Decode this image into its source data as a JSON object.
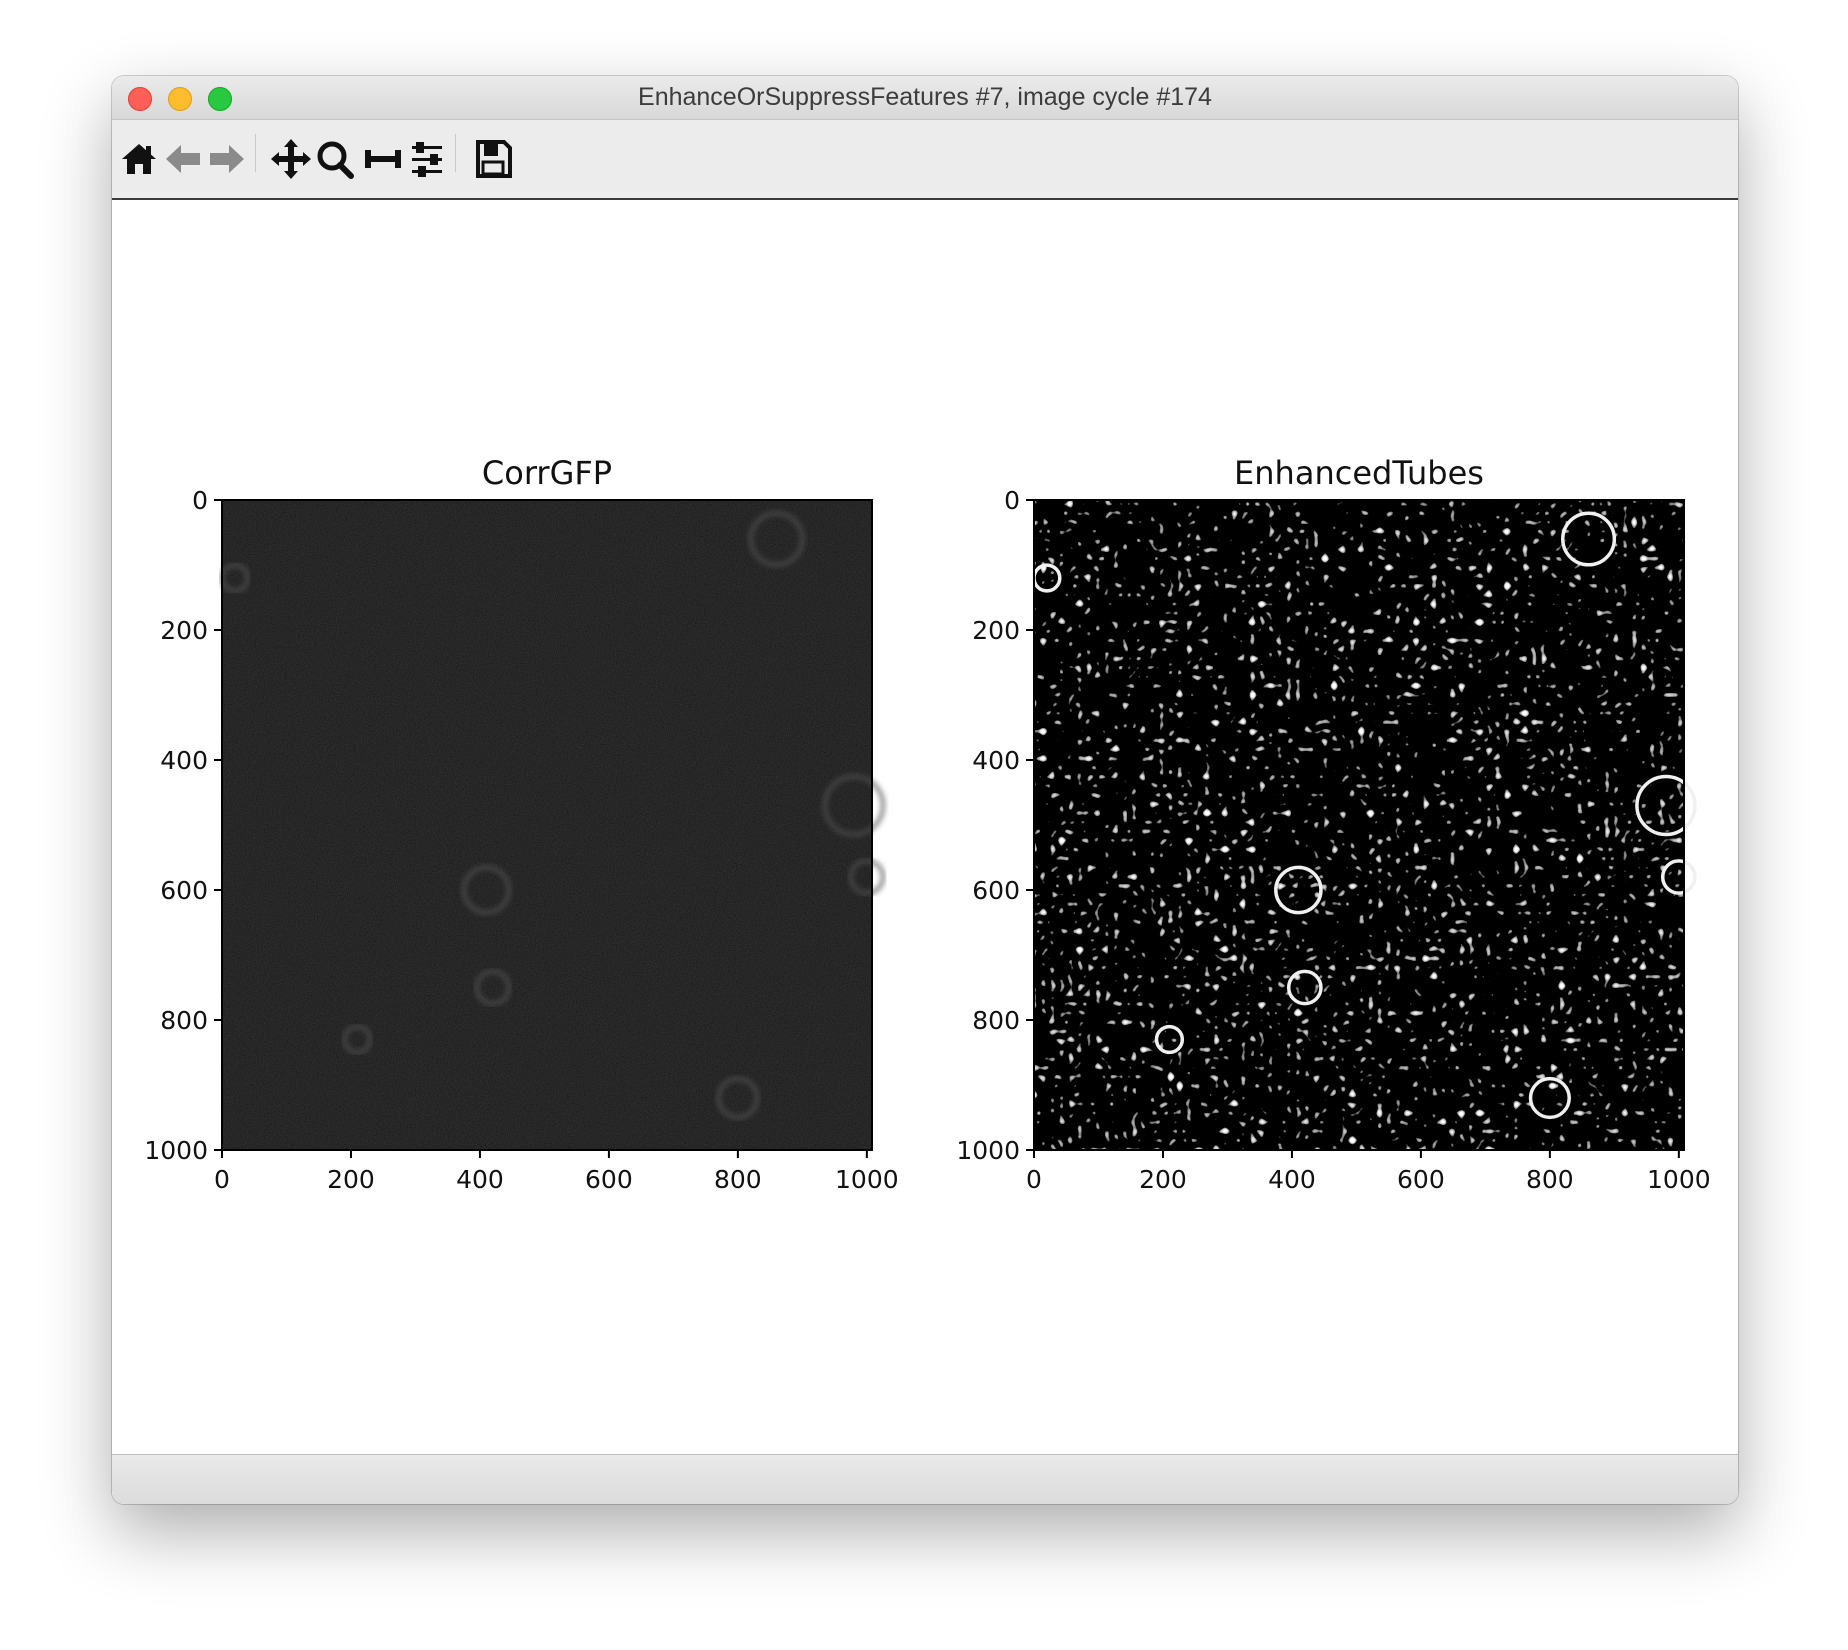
{
  "window": {
    "title": "EnhanceOrSuppressFeatures #7, image cycle #174"
  },
  "toolbar": {
    "buttons": [
      {
        "name": "home-icon",
        "tooltip": "Home"
      },
      {
        "name": "back-icon",
        "tooltip": "Back"
      },
      {
        "name": "forward-icon",
        "tooltip": "Forward"
      },
      {
        "name": "pan-icon",
        "tooltip": "Pan"
      },
      {
        "name": "zoom-icon",
        "tooltip": "Zoom"
      },
      {
        "name": "subplots-icon",
        "tooltip": "Subplots"
      },
      {
        "name": "customize-icon",
        "tooltip": "Customize"
      },
      {
        "name": "save-icon",
        "tooltip": "Save"
      }
    ]
  },
  "status": {
    "text": ""
  },
  "chart_data": [
    {
      "type": "heatmap",
      "title": "CorrGFP",
      "colormap": "gray",
      "image": "dark fluorescence micrograph with faint bright structures",
      "xlim": [
        0,
        1008
      ],
      "ylim": [
        1000,
        0
      ],
      "xticks": [
        0,
        200,
        400,
        600,
        800,
        1000
      ],
      "yticks": [
        0,
        200,
        400,
        600,
        800,
        1000
      ],
      "xlabel": "",
      "ylabel": ""
    },
    {
      "type": "heatmap",
      "title": "EnhancedTubes",
      "colormap": "gray",
      "image": "edge-enhanced texture with bright tubular features",
      "xlim": [
        0,
        1008
      ],
      "ylim": [
        1000,
        0
      ],
      "xticks": [
        0,
        200,
        400,
        600,
        800,
        1000
      ],
      "yticks": [
        0,
        200,
        400,
        600,
        800,
        1000
      ],
      "xlabel": "",
      "ylabel": ""
    }
  ]
}
